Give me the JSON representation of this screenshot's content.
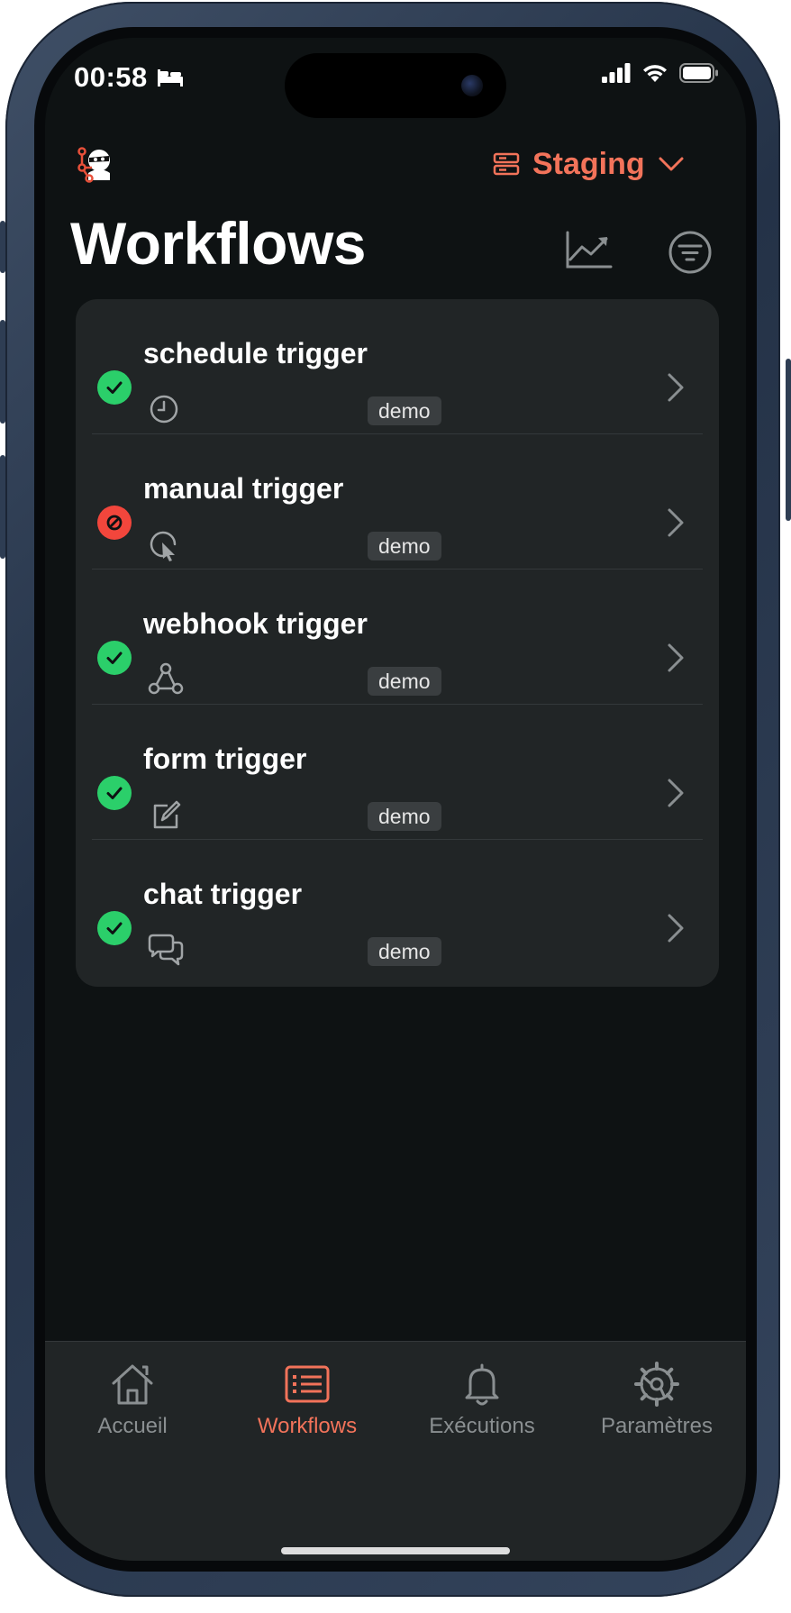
{
  "status_bar": {
    "time": "00:58"
  },
  "header": {
    "environment_label": "Staging",
    "title": "Workflows"
  },
  "workflows": [
    {
      "name": "schedule trigger",
      "status": "active",
      "trigger_icon": "clock-icon",
      "tag": "demo"
    },
    {
      "name": "manual trigger",
      "status": "inactive",
      "trigger_icon": "cursor-click-icon",
      "tag": "demo"
    },
    {
      "name": "webhook trigger",
      "status": "active",
      "trigger_icon": "webhook-icon",
      "tag": "demo"
    },
    {
      "name": "form trigger",
      "status": "active",
      "trigger_icon": "edit-form-icon",
      "tag": "demo"
    },
    {
      "name": "chat trigger",
      "status": "active",
      "trigger_icon": "chat-bubbles-icon",
      "tag": "demo"
    }
  ],
  "tabbar": {
    "items": [
      {
        "label": "Accueil",
        "icon": "home-icon",
        "active": false
      },
      {
        "label": "Workflows",
        "icon": "list-icon",
        "active": true
      },
      {
        "label": "Exécutions",
        "icon": "bell-icon",
        "active": false
      },
      {
        "label": "Paramètres",
        "icon": "gear-icon",
        "active": false
      }
    ]
  },
  "colors": {
    "accent": "#f2735a",
    "success": "#2bcf6a",
    "error": "#f2463c",
    "background": "#0e1213",
    "card": "#212526"
  }
}
